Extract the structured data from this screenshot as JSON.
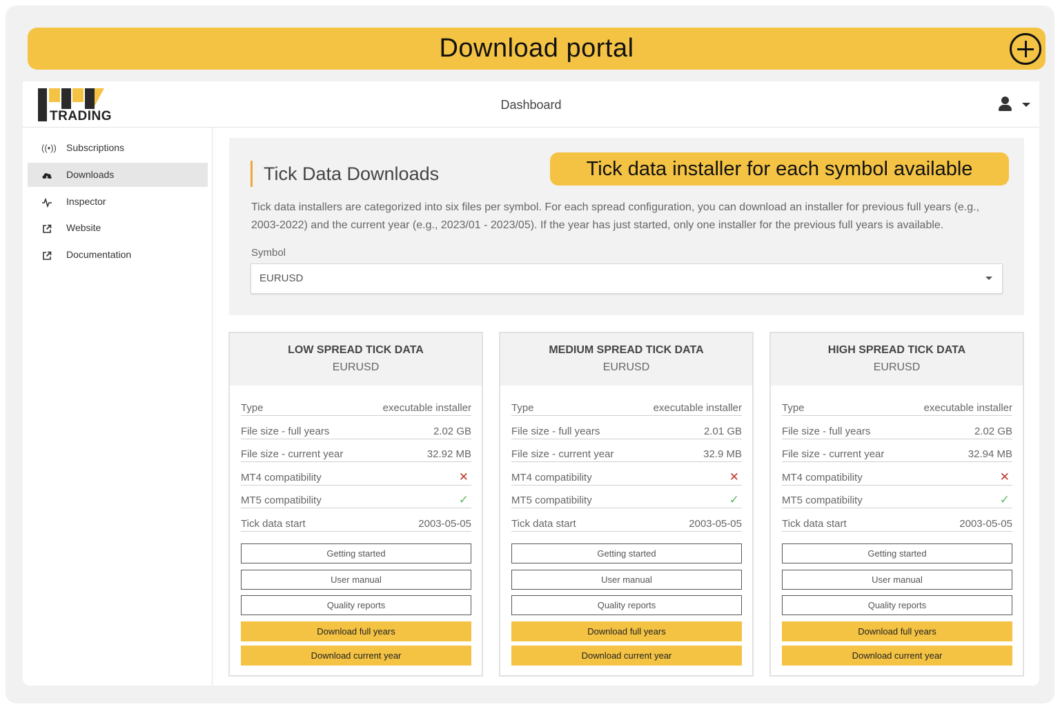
{
  "banner": {
    "title": "Download portal"
  },
  "brand": {
    "name": "TRADING"
  },
  "header": {
    "title": "Dashboard"
  },
  "sidebar": {
    "items": [
      {
        "label": "Subscriptions",
        "icon": "broadcast-icon",
        "active": false
      },
      {
        "label": "Downloads",
        "icon": "cloud-download-icon",
        "active": true
      },
      {
        "label": "Inspector",
        "icon": "pulse-icon",
        "active": false
      },
      {
        "label": "Website",
        "icon": "external-link-icon",
        "active": false
      },
      {
        "label": "Documentation",
        "icon": "external-link-icon",
        "active": false
      }
    ]
  },
  "intro": {
    "heading": "Tick Data Downloads",
    "callout": "Tick data installer for each symbol available",
    "text": "Tick data installers are categorized into six files per symbol. For each spread configuration, you can download an installer for previous full years (e.g., 2003-2022) and the current year (e.g., 2023/01 - 2023/05). If the year has just started, only one installer for the previous full years is available.",
    "symbol_label": "Symbol",
    "symbol_value": "EURUSD"
  },
  "cards": [
    {
      "title": "LOW SPREAD TICK DATA",
      "symbol": "EURUSD",
      "rows": {
        "type_label": "Type",
        "type_value": "executable installer",
        "full_label": "File size - full years",
        "full_value": "2.02 GB",
        "current_label": "File size - current year",
        "current_value": "32.92 MB",
        "mt4_label": "MT4 compatibility",
        "mt5_label": "MT5 compatibility",
        "start_label": "Tick data start",
        "start_value": "2003-05-05"
      },
      "buttons": {
        "getting_started": "Getting started",
        "user_manual": "User manual",
        "quality_reports": "Quality reports",
        "download_full": "Download full years",
        "download_current": "Download current year"
      }
    },
    {
      "title": "MEDIUM SPREAD TICK DATA",
      "symbol": "EURUSD",
      "rows": {
        "type_label": "Type",
        "type_value": "executable installer",
        "full_label": "File size - full years",
        "full_value": "2.01 GB",
        "current_label": "File size - current year",
        "current_value": "32.9 MB",
        "mt4_label": "MT4 compatibility",
        "mt5_label": "MT5 compatibility",
        "start_label": "Tick data start",
        "start_value": "2003-05-05"
      },
      "buttons": {
        "getting_started": "Getting started",
        "user_manual": "User manual",
        "quality_reports": "Quality reports",
        "download_full": "Download full years",
        "download_current": "Download current year"
      }
    },
    {
      "title": "HIGH SPREAD TICK DATA",
      "symbol": "EURUSD",
      "rows": {
        "type_label": "Type",
        "type_value": "executable installer",
        "full_label": "File size - full years",
        "full_value": "2.02 GB",
        "current_label": "File size - current year",
        "current_value": "32.94 MB",
        "mt4_label": "MT4 compatibility",
        "mt5_label": "MT5 compatibility",
        "start_label": "Tick data start",
        "start_value": "2003-05-05"
      },
      "buttons": {
        "getting_started": "Getting started",
        "user_manual": "User manual",
        "quality_reports": "Quality reports",
        "download_full": "Download full years",
        "download_current": "Download current year"
      }
    }
  ],
  "colors": {
    "accent": "#f4c343",
    "cross": "#c0392b",
    "check": "#5cb85c"
  }
}
